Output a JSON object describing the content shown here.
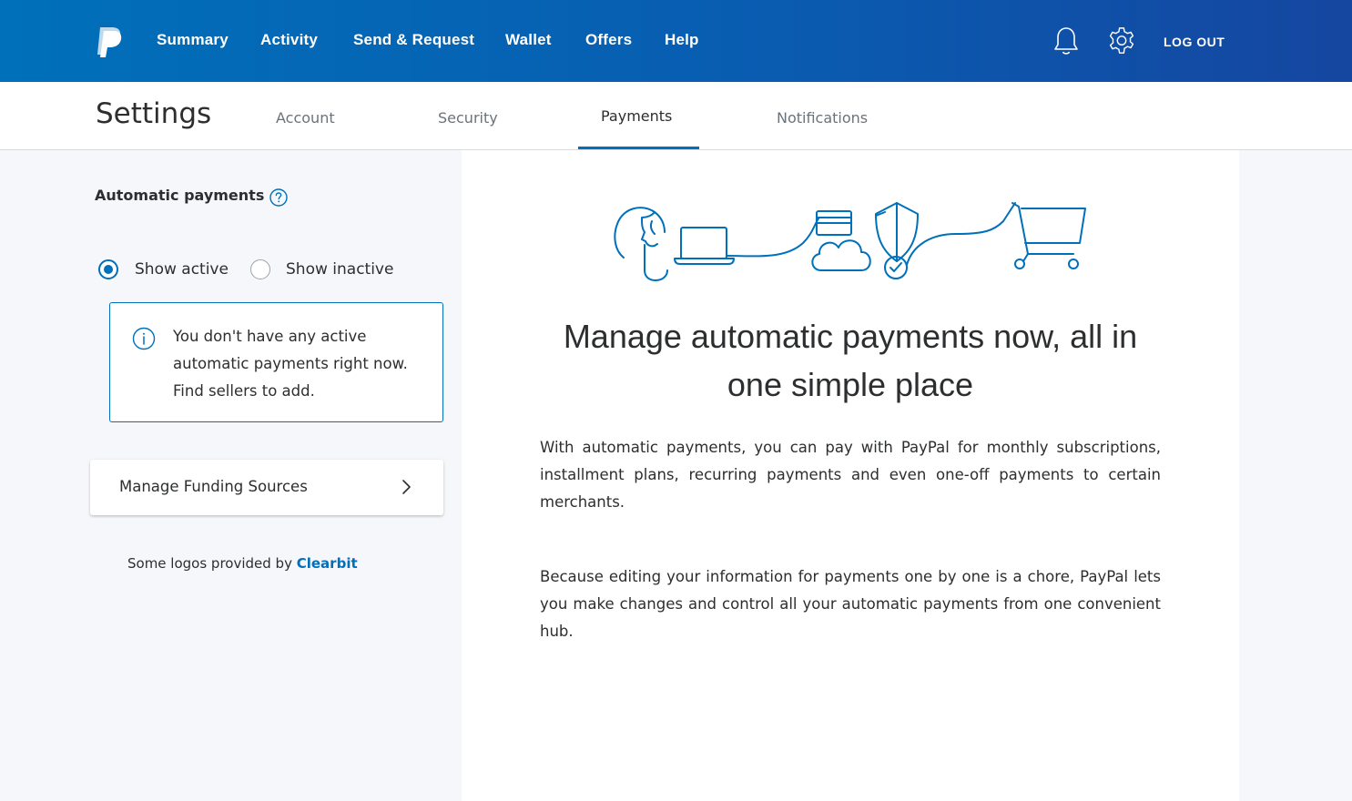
{
  "nav": {
    "items": [
      "Summary",
      "Activity",
      "Send & Request",
      "Wallet",
      "Offers",
      "Help"
    ],
    "logout_label": "LOG OUT",
    "icons": {
      "logo": "paypal-logo",
      "bell": "bell-icon",
      "settings": "gear-icon"
    }
  },
  "settings": {
    "title": "Settings",
    "tabs": [
      "Account",
      "Security",
      "Payments",
      "Notifications"
    ],
    "active_tab": "Payments"
  },
  "sidebar": {
    "heading": "Automatic payments",
    "filter_options": [
      {
        "label": "Show active",
        "selected": true
      },
      {
        "label": "Show inactive",
        "selected": false
      }
    ],
    "info_message": "You don't have any active automatic payments right now. Find sellers to add.",
    "funding_link": "Manage Funding Sources",
    "credits_prefix": "Some logos provided by",
    "credits_link": "Clearbit"
  },
  "main": {
    "headline": "Manage automatic payments now, all in one simple place",
    "paragraphs": [
      "With automatic payments, you can pay with PayPal for monthly subscriptions, installment plans, recurring payments and even one-off payments to certain merchants.",
      "Because editing your information for payments one by one is a chore, PayPal lets you make changes and control all your automatic payments from one convenient hub."
    ]
  },
  "colors": {
    "brand_blue": "#0070ba",
    "nav_gradient_end": "#1546a0",
    "text": "#2c2e2f",
    "muted_text": "#6c7378"
  }
}
